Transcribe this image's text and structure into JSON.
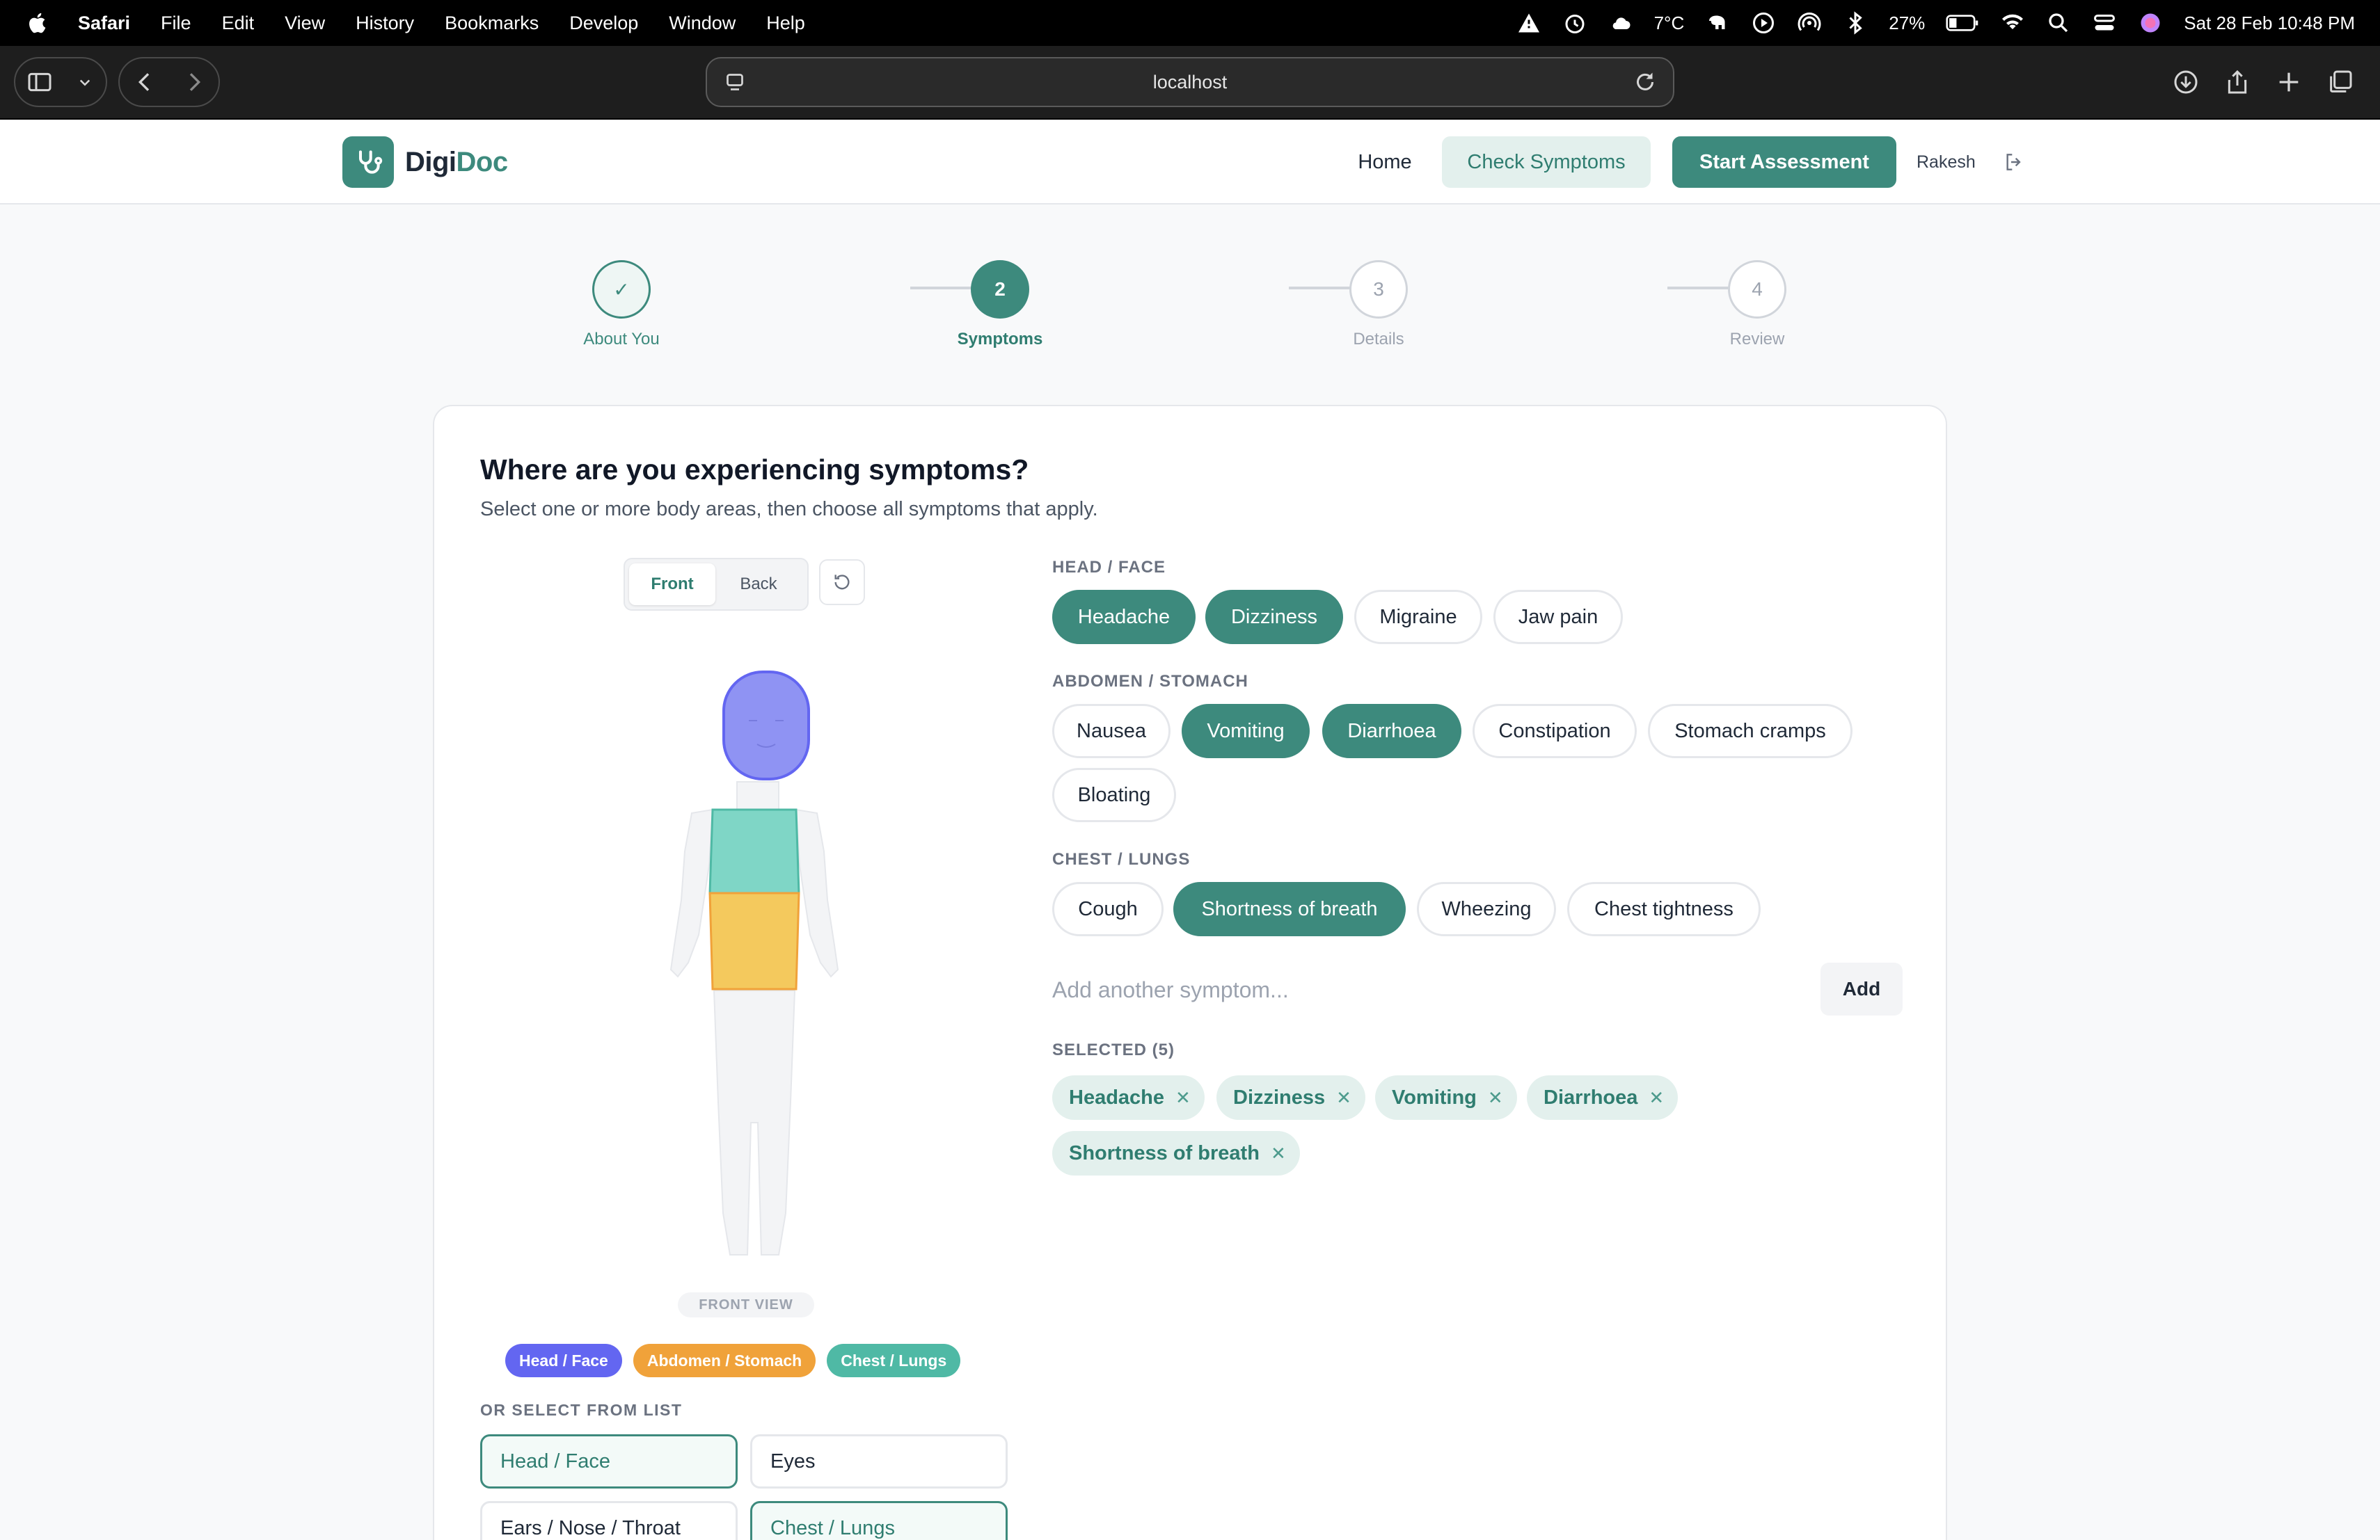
{
  "menubar": {
    "app": "Safari",
    "items": [
      "File",
      "Edit",
      "View",
      "History",
      "Bookmarks",
      "Develop",
      "Window",
      "Help"
    ],
    "temperature": "7°C",
    "battery": "27%",
    "datetime": "Sat 28 Feb  10:48 PM"
  },
  "browser": {
    "url": "localhost"
  },
  "header": {
    "logo_part1": "Digi",
    "logo_part2": "Doc",
    "nav_home": "Home",
    "nav_check": "Check Symptoms",
    "nav_start": "Start Assessment",
    "user": "Rakesh"
  },
  "stepper": {
    "steps": [
      {
        "num": "✓",
        "label": "About You",
        "state": "done"
      },
      {
        "num": "2",
        "label": "Symptoms",
        "state": "active"
      },
      {
        "num": "3",
        "label": "Details",
        "state": "pending"
      },
      {
        "num": "4",
        "label": "Review",
        "state": "pending"
      }
    ]
  },
  "card": {
    "title": "Where are you experiencing symptoms?",
    "subtitle": "Select one or more body areas, then choose all symptoms that apply.",
    "view_front": "Front",
    "view_back": "Back",
    "front_view_label": "FRONT VIEW",
    "legend": [
      {
        "label": "Head / Face",
        "color": "#6366f1"
      },
      {
        "label": "Abdomen / Stomach",
        "color": "#f0a23a"
      },
      {
        "label": "Chest / Lungs",
        "color": "#4fb9a5"
      }
    ],
    "or_select_label": "OR SELECT FROM LIST",
    "regions": [
      {
        "label": "Head / Face",
        "selected": true
      },
      {
        "label": "Eyes",
        "selected": false
      },
      {
        "label": "Ears / Nose / Throat",
        "selected": false
      },
      {
        "label": "Chest / Lungs",
        "selected": true
      }
    ],
    "sections": [
      {
        "title": "HEAD / FACE",
        "symptoms": [
          "Headache",
          "Dizziness",
          "Migraine",
          "Jaw pain"
        ]
      },
      {
        "title": "ABDOMEN / STOMACH",
        "symptoms": [
          "Nausea",
          "Vomiting",
          "Diarrhoea",
          "Constipation",
          "Stomach cramps",
          "Bloating"
        ]
      },
      {
        "title": "CHEST / LUNGS",
        "symptoms": [
          "Cough",
          "Shortness of breath",
          "Wheezing",
          "Chest tightness"
        ]
      }
    ],
    "add_placeholder": "Add another symptom...",
    "add_button": "Add",
    "selected_label": "SELECTED (5)",
    "selected": [
      "Headache",
      "Dizziness",
      "Vomiting",
      "Diarrhoea",
      "Shortness of breath"
    ]
  },
  "colors": {
    "primary": "#3d8a7d",
    "head": "#8f93f3",
    "chest": "#7fd6c6",
    "abdomen": "#f4c95d"
  }
}
